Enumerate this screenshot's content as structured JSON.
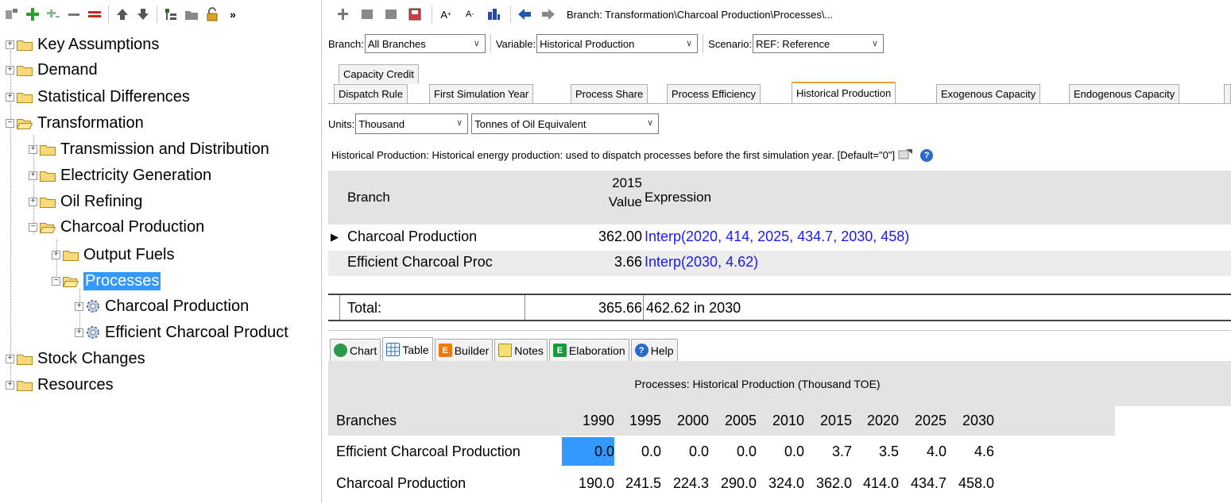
{
  "tree": {
    "nodes": [
      {
        "label": "Key Assumptions",
        "expander": "+"
      },
      {
        "label": "Demand",
        "expander": "+"
      },
      {
        "label": "Statistical Differences",
        "expander": "+"
      },
      {
        "label": "Transformation",
        "expander": "−"
      },
      {
        "label": "Transmission and Distribution",
        "expander": "+"
      },
      {
        "label": "Electricity Generation",
        "expander": "+"
      },
      {
        "label": "Oil Refining",
        "expander": "+"
      },
      {
        "label": "Charcoal Production",
        "expander": "−"
      },
      {
        "label": "Output Fuels",
        "expander": "+"
      },
      {
        "label": "Processes",
        "expander": "−"
      },
      {
        "label": "Charcoal Production",
        "expander": "+"
      },
      {
        "label": "Efficient Charcoal Product",
        "expander": "+"
      },
      {
        "label": "Stock Changes",
        "expander": "+"
      },
      {
        "label": "Resources",
        "expander": "+"
      }
    ]
  },
  "left_toolbar": {
    "more": "»"
  },
  "right_toolbar": {
    "branch_path": "Branch: Transformation\\Charcoal Production\\Processes\\..."
  },
  "selectors": {
    "branch_label": "Branch:",
    "branch_value": "All Branches",
    "variable_label": "Variable:",
    "variable_value": "Historical Production",
    "scenario_label": "Scenario:",
    "scenario_value": "REF: Reference"
  },
  "tabs": {
    "row1": [
      "Capacity Credit"
    ],
    "row2": [
      "Dispatch Rule",
      "First Simulation Year",
      "Process Share",
      "Process Efficiency",
      "Historical Production",
      "Exogenous Capacity",
      "Endogenous Capacity"
    ],
    "active": "Historical Production"
  },
  "units": {
    "label": "Units:",
    "scale": "Thousand",
    "unit": "Tonnes of Oil Equivalent"
  },
  "description": "Historical Production: Historical energy production: used to dispatch processes before the first simulation year. [Default=\"0\"]",
  "grid": {
    "col_branch": "Branch",
    "col_year": "2015",
    "col_value": "Value",
    "col_expression": "Expression",
    "rows": [
      {
        "branch": "Charcoal Production",
        "value": "362.00",
        "expression": "Interp(2020, 414, 2025, 434.7, 2030, 458)"
      },
      {
        "branch": "Efficient Charcoal Proc",
        "value": "3.66",
        "expression": "Interp(2030, 4.62)"
      }
    ],
    "total": {
      "label": "Total:",
      "value": "365.66",
      "expression": "462.62 in 2030"
    }
  },
  "bottom_tabs": [
    {
      "label": "Chart",
      "icon": "chart-icon"
    },
    {
      "label": "Table",
      "icon": "table-icon"
    },
    {
      "label": "Builder",
      "icon": "builder-icon"
    },
    {
      "label": "Notes",
      "icon": "notes-icon"
    },
    {
      "label": "Elaboration",
      "icon": "elaboration-icon"
    },
    {
      "label": "Help",
      "icon": "help-icon"
    }
  ],
  "table": {
    "caption": "Processes: Historical Production (Thousand TOE)",
    "header": "Branches",
    "years": [
      "1990",
      "1995",
      "2000",
      "2005",
      "2010",
      "2015",
      "2020",
      "2025",
      "2030"
    ],
    "rows": [
      {
        "name": "Efficient Charcoal Production",
        "values": [
          "0.0",
          "0.0",
          "0.0",
          "0.0",
          "0.0",
          "3.7",
          "3.5",
          "4.0",
          "4.6"
        ]
      },
      {
        "name": "Charcoal Production",
        "values": [
          "190.0",
          "241.5",
          "224.3",
          "290.0",
          "324.0",
          "362.0",
          "414.0",
          "434.7",
          "458.0"
        ]
      }
    ]
  },
  "colors": {
    "selection": "#3399ff",
    "expression": "#1a1aff",
    "active_tab": "#f0a030",
    "header_bg": "#e3e3e3"
  }
}
